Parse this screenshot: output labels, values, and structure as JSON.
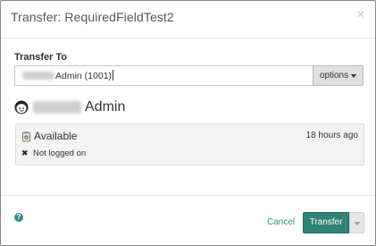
{
  "dialog": {
    "title": "Transfer: RequiredFieldTest2",
    "close_symbol": "×"
  },
  "transfer_to": {
    "label": "Transfer To",
    "value_visible": "Admin (1001)",
    "options_label": "options"
  },
  "user": {
    "name_visible": "Admin",
    "icon": "user-face-icon"
  },
  "status": {
    "state": "Available",
    "time": "18 hours ago",
    "logon_symbol": "✖",
    "logon": "Not logged on",
    "icon": "status-available-icon"
  },
  "footer": {
    "help_symbol": "?",
    "cancel_label": "Cancel",
    "transfer_label": "Transfer",
    "accent_color": "#2f8375"
  }
}
